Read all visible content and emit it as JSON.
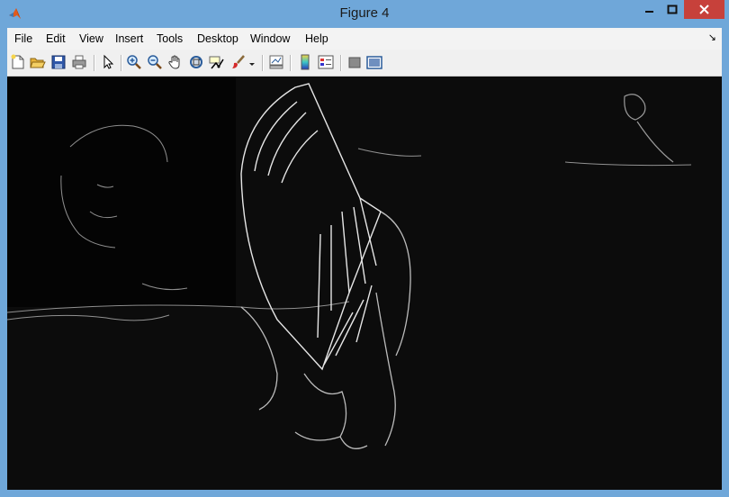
{
  "window": {
    "title": "Figure 4"
  },
  "menu": {
    "items": [
      "File",
      "Edit",
      "View",
      "Insert",
      "Tools",
      "Desktop",
      "Window",
      "Help"
    ]
  },
  "toolbar": {
    "buttons": [
      "new-figure-icon",
      "open-file-icon",
      "save-icon",
      "print-icon",
      "edit-plot-icon",
      "zoom-in-icon",
      "zoom-out-icon",
      "pan-icon",
      "rotate-3d-icon",
      "data-cursor-icon",
      "brush-icon",
      "brush-dropdown-icon",
      "link-plot-icon",
      "colorbar-icon",
      "legend-icon",
      "hide-plot-tools-icon",
      "show-plot-tools-icon"
    ]
  },
  "colors": {
    "titlebar": "#6fa7d9",
    "close": "#c7413b",
    "canvas": "#0b0b0b"
  }
}
